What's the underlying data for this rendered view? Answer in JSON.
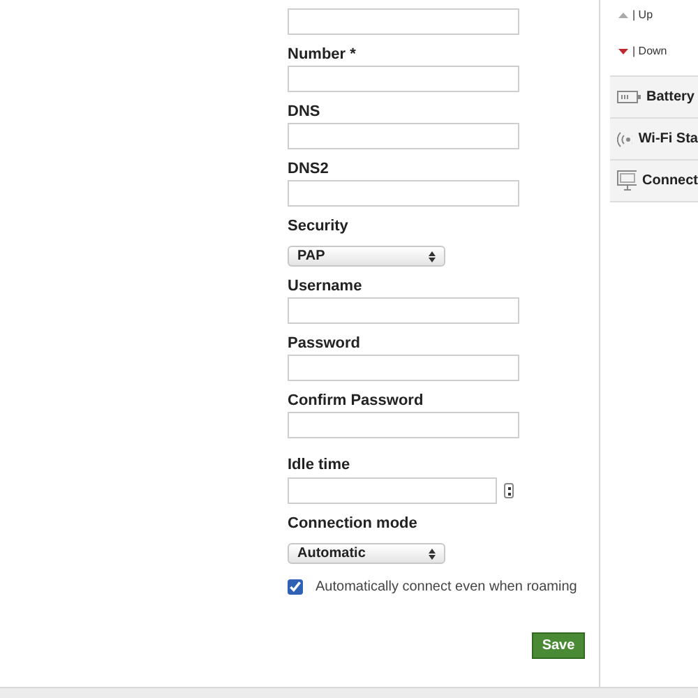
{
  "form": {
    "fields": [
      {
        "kind": "text"
      },
      {
        "kind": "text",
        "label": "Number *"
      },
      {
        "kind": "text",
        "label": "DNS"
      },
      {
        "kind": "text",
        "label": "DNS2"
      },
      {
        "kind": "select",
        "label": "Security",
        "value": "PAP"
      },
      {
        "kind": "text",
        "label": "Username"
      },
      {
        "kind": "password",
        "label": "Password"
      },
      {
        "kind": "password",
        "label": "Confirm Password"
      },
      {
        "kind": "number",
        "label": "Idle time"
      },
      {
        "kind": "select",
        "label": "Connection mode",
        "value": "Automatic"
      },
      {
        "kind": "checkbox",
        "label": "Automatically connect even when roaming",
        "checked": true
      }
    ],
    "save_button": "Save"
  },
  "sidebar": {
    "legend": [
      {
        "kind": "up",
        "label": "| Up"
      },
      {
        "kind": "down",
        "label": "| Down"
      }
    ],
    "items": [
      {
        "kind": "battery",
        "label": "Battery"
      },
      {
        "kind": "wifi",
        "label": "Wi-Fi Sta"
      },
      {
        "kind": "monitor",
        "label": "Connect"
      }
    ]
  }
}
